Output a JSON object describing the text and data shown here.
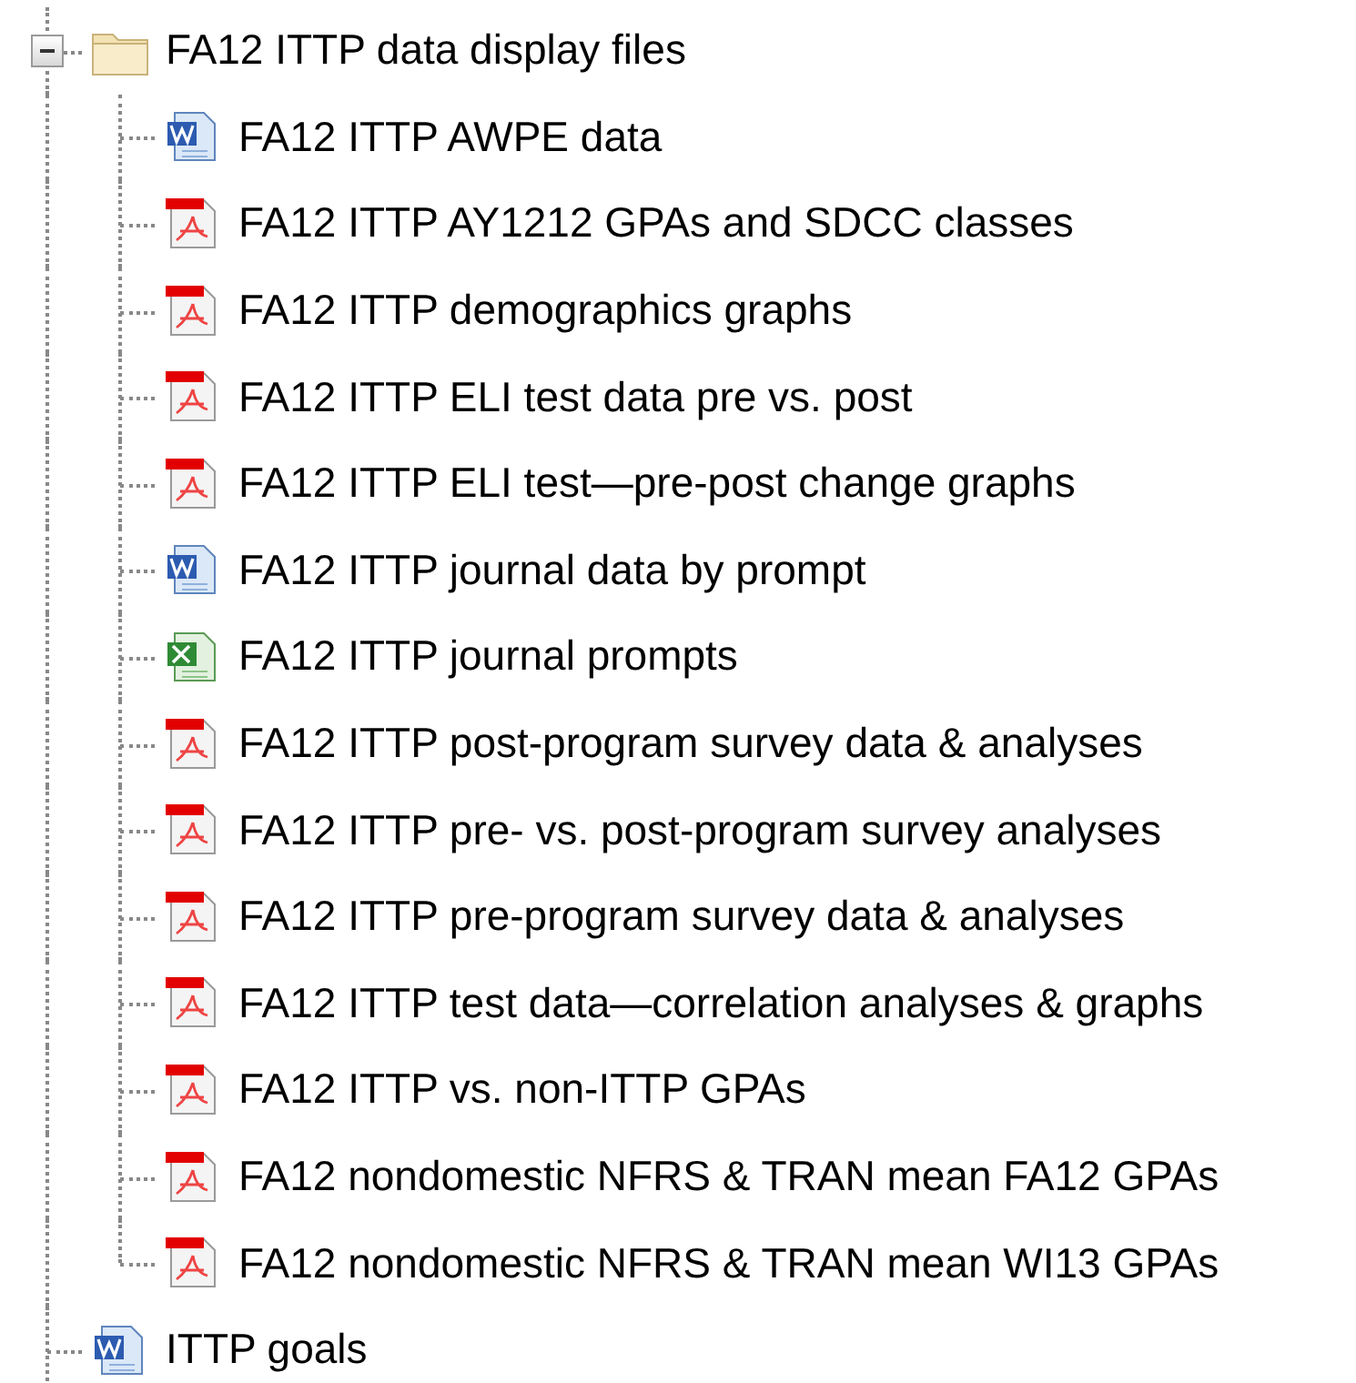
{
  "tree": [
    {
      "kind": "folder",
      "label": "FA12 ITTP data display files",
      "expanded": true,
      "children": [
        {
          "kind": "word",
          "label": "FA12 ITTP AWPE data"
        },
        {
          "kind": "pdf",
          "label": "FA12 ITTP AY1212 GPAs and SDCC classes"
        },
        {
          "kind": "pdf",
          "label": "FA12 ITTP demographics graphs"
        },
        {
          "kind": "pdf",
          "label": "FA12 ITTP ELI test data pre vs. post"
        },
        {
          "kind": "pdf",
          "label": "FA12 ITTP ELI test—pre-post change graphs"
        },
        {
          "kind": "word",
          "label": "FA12 ITTP journal data by prompt"
        },
        {
          "kind": "excel",
          "label": "FA12 ITTP journal prompts"
        },
        {
          "kind": "pdf",
          "label": "FA12 ITTP post-program survey data & analyses"
        },
        {
          "kind": "pdf",
          "label": "FA12 ITTP pre- vs. post-program survey analyses"
        },
        {
          "kind": "pdf",
          "label": "FA12 ITTP pre-program survey data & analyses"
        },
        {
          "kind": "pdf",
          "label": "FA12 ITTP test data—correlation analyses & graphs"
        },
        {
          "kind": "pdf",
          "label": "FA12 ITTP vs. non-ITTP GPAs"
        },
        {
          "kind": "pdf",
          "label": "FA12 nondomestic NFRS & TRAN mean FA12 GPAs"
        },
        {
          "kind": "pdf",
          "label": "FA12 nondomestic NFRS & TRAN mean WI13 GPAs"
        }
      ]
    },
    {
      "kind": "word",
      "label": "ITTP goals"
    }
  ]
}
